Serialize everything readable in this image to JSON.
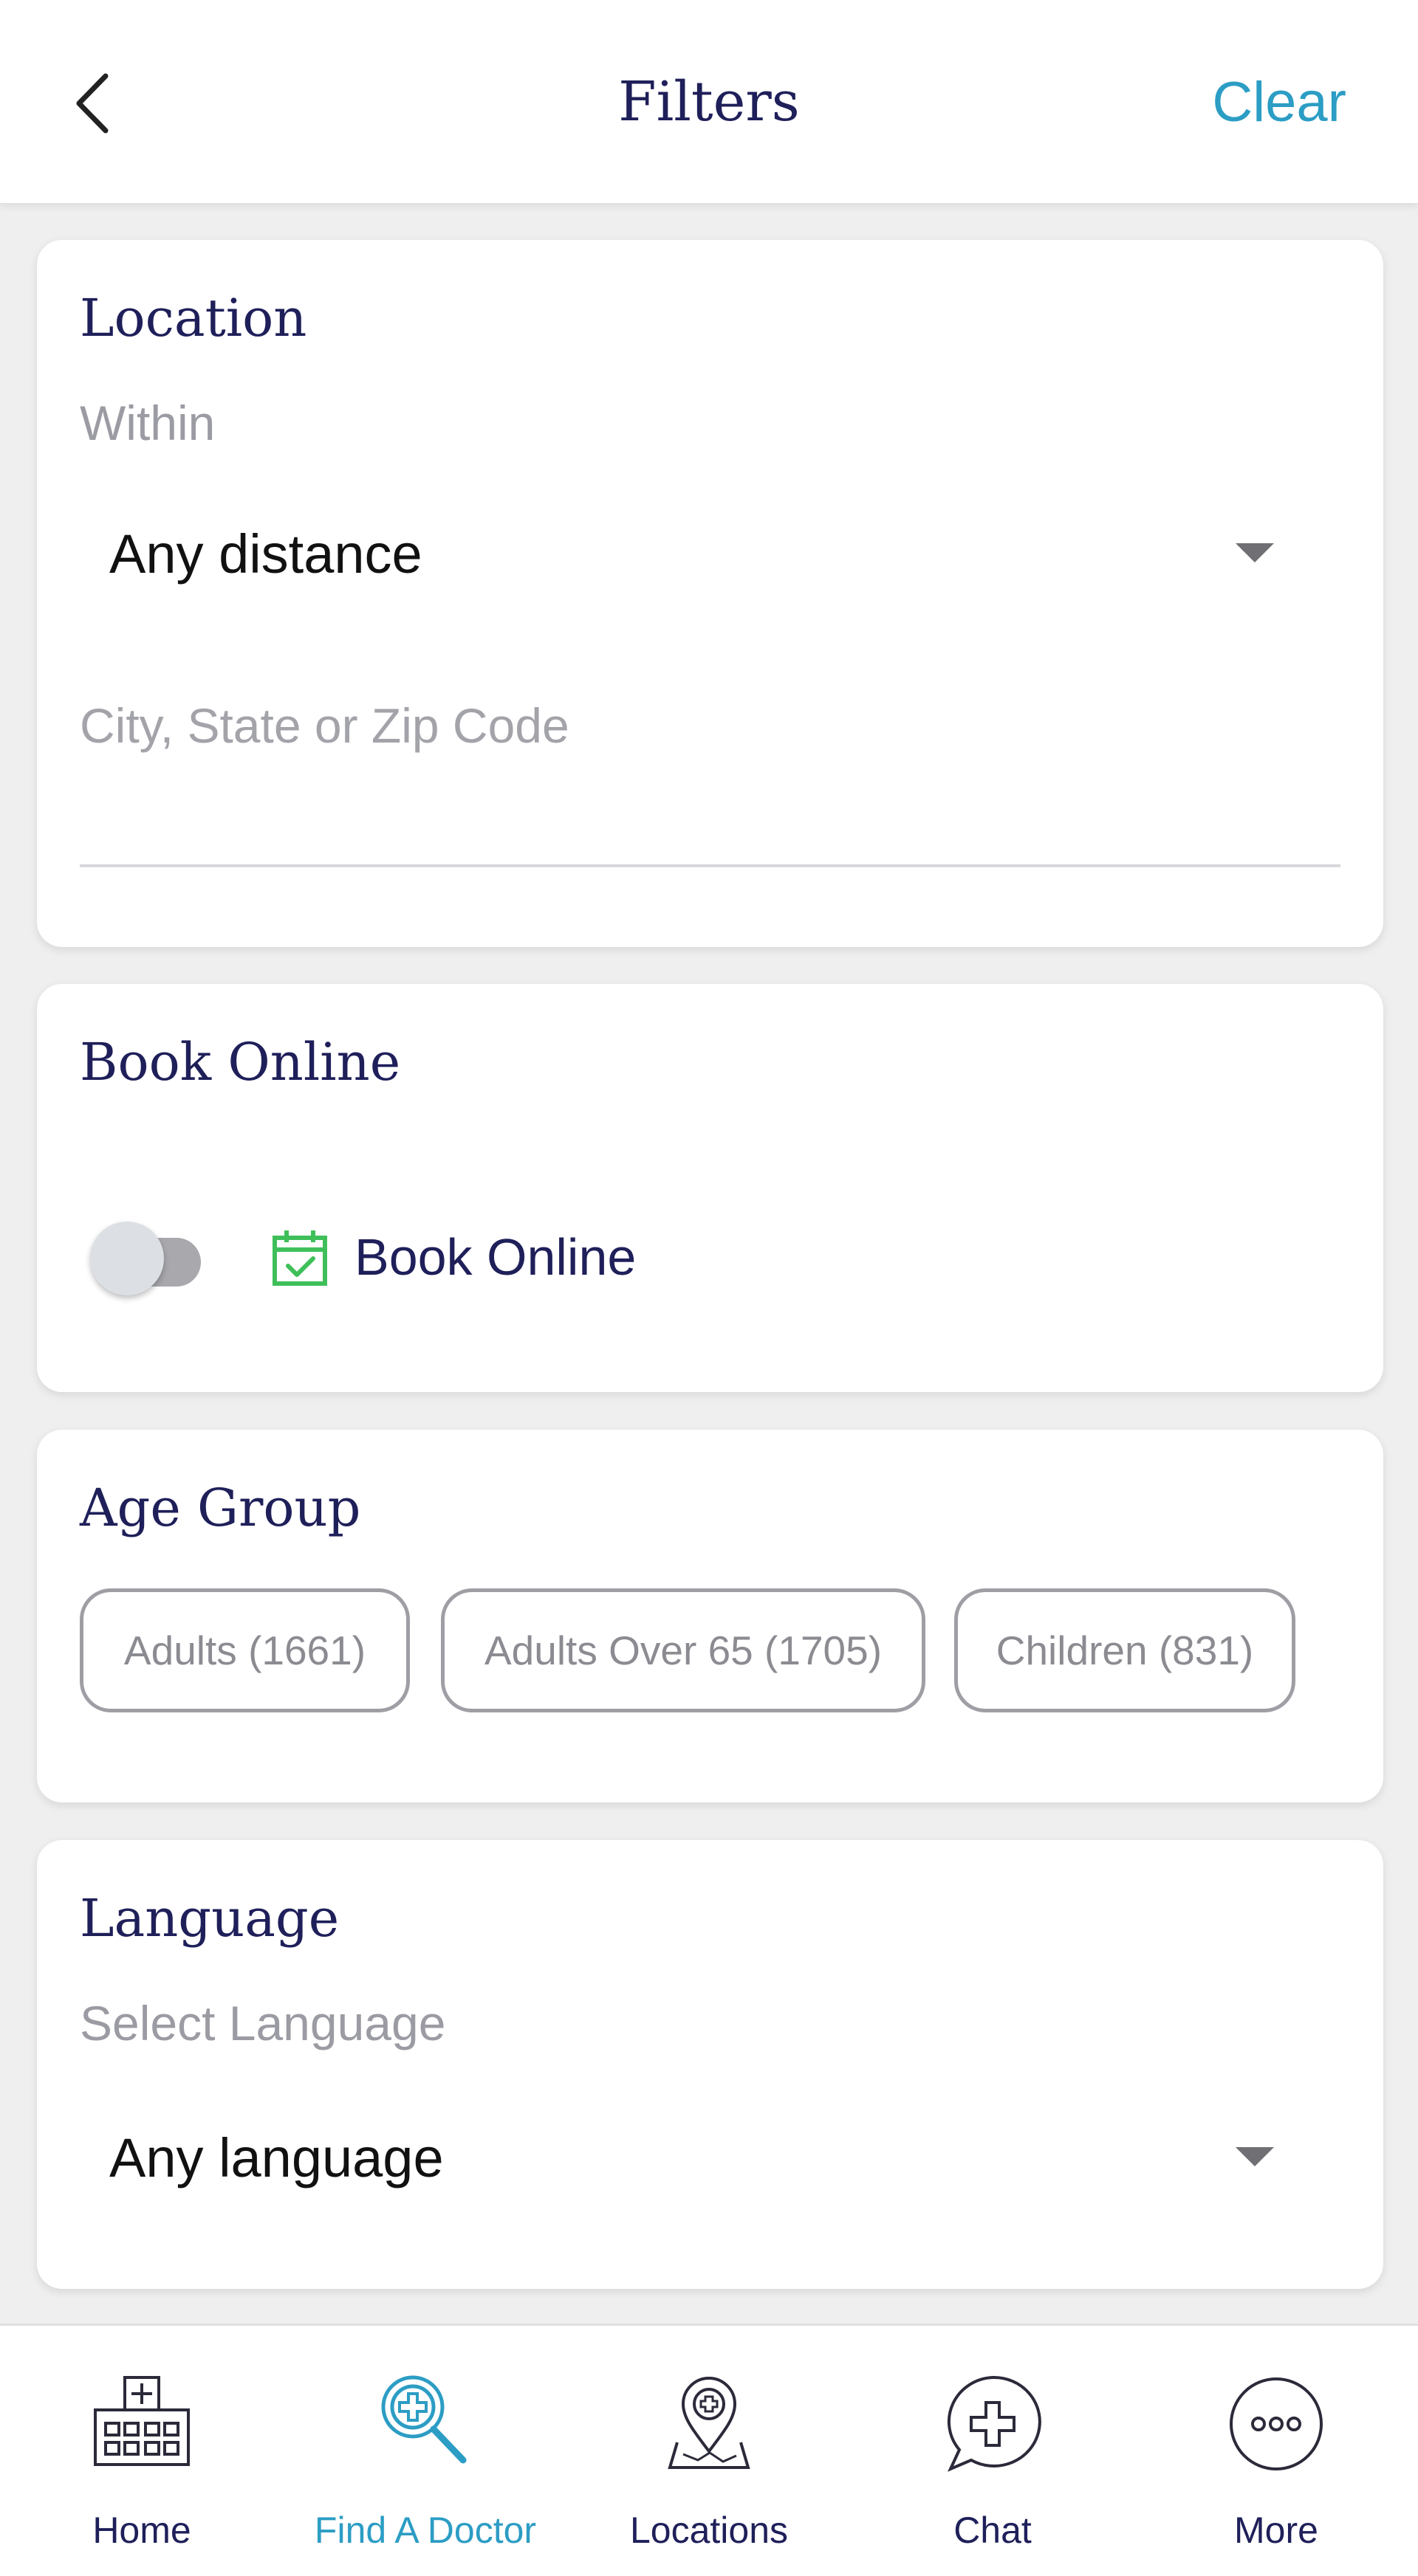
{
  "header": {
    "title": "Filters",
    "clear_label": "Clear",
    "back_icon": "chevron-left-icon"
  },
  "location": {
    "title": "Location",
    "within_label": "Within",
    "distance_value": "Any distance",
    "city_placeholder": "City, State or Zip Code",
    "city_value": ""
  },
  "book_online": {
    "title": "Book Online",
    "toggle_on": false,
    "option_label": "Book Online",
    "icon": "calendar-check-icon",
    "icon_color": "#3fbf5a"
  },
  "age_group": {
    "title": "Age Group",
    "chips": [
      {
        "label": "Adults (1661)"
      },
      {
        "label": "Adults Over 65 (1705)"
      },
      {
        "label": "Children (831)"
      }
    ]
  },
  "language": {
    "title": "Language",
    "select_label": "Select Language",
    "value": "Any language"
  },
  "tabbar": {
    "active_index": 1,
    "items": [
      {
        "label": "Home",
        "icon": "hospital-icon"
      },
      {
        "label": "Find A Doctor",
        "icon": "doctor-search-icon"
      },
      {
        "label": "Locations",
        "icon": "location-pin-icon"
      },
      {
        "label": "Chat",
        "icon": "chat-bubble-icon"
      },
      {
        "label": "More",
        "icon": "more-dots-icon"
      }
    ]
  },
  "colors": {
    "accent": "#2c9dc4",
    "navy": "#1f1f5a",
    "background": "#efeff0"
  }
}
